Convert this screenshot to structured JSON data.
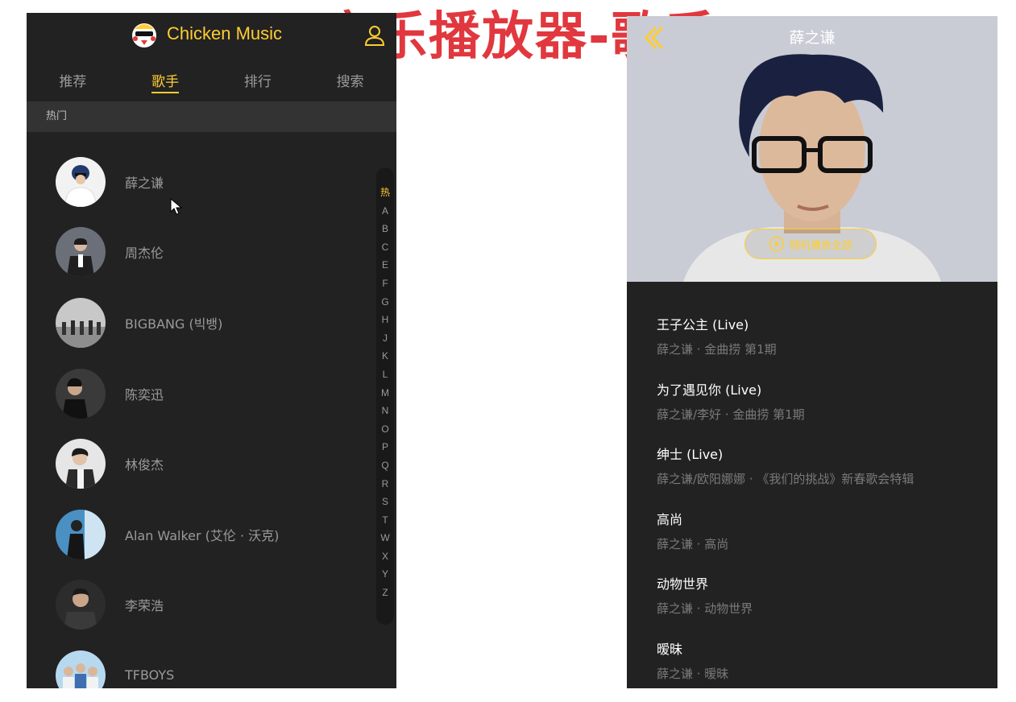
{
  "slide": {
    "title": "音乐播放器-歌手"
  },
  "app": {
    "title": "Chicken Music"
  },
  "tabs": [
    "推荐",
    "歌手",
    "排行",
    "搜索"
  ],
  "singer_group": {
    "title": "热门",
    "singers": [
      {
        "name": "薛之谦"
      },
      {
        "name": "周杰伦"
      },
      {
        "name": "BIGBANG (빅뱅)"
      },
      {
        "name": "陈奕迅"
      },
      {
        "name": "林俊杰"
      },
      {
        "name": "Alan Walker (艾伦 · 沃克)"
      },
      {
        "name": "李荣浩"
      },
      {
        "name": "TFBOYS"
      }
    ]
  },
  "shortcut_list": [
    "热",
    "A",
    "B",
    "C",
    "E",
    "F",
    "G",
    "H",
    "J",
    "K",
    "L",
    "M",
    "N",
    "O",
    "P",
    "Q",
    "R",
    "S",
    "T",
    "W",
    "X",
    "Y",
    "Z"
  ],
  "detail": {
    "title": "薛之谦",
    "play_all_label": "随机播放全部",
    "songs": [
      {
        "name": "王子公主 (Live)",
        "desc": "薛之谦 · 金曲捞 第1期"
      },
      {
        "name": "为了遇见你 (Live)",
        "desc": "薛之谦/李好 · 金曲捞 第1期"
      },
      {
        "name": "绅士 (Live)",
        "desc": "薛之谦/欧阳娜娜 · 《我们的挑战》新春歌会特辑"
      },
      {
        "name": "高尚",
        "desc": "薛之谦 · 高尚"
      },
      {
        "name": "动物世界",
        "desc": "薛之谦 · 动物世界"
      },
      {
        "name": "暧昧",
        "desc": "薛之谦 · 暧昧"
      }
    ]
  },
  "colors": {
    "theme": "#ffcd32",
    "background": "#222222",
    "highlight": "#333333",
    "text_d": "#9a9a9a"
  },
  "icons": {
    "logo": "chicken-logo-icon",
    "user": "user-icon",
    "back": "back-arrow-icon",
    "play": "play-circle-icon"
  }
}
